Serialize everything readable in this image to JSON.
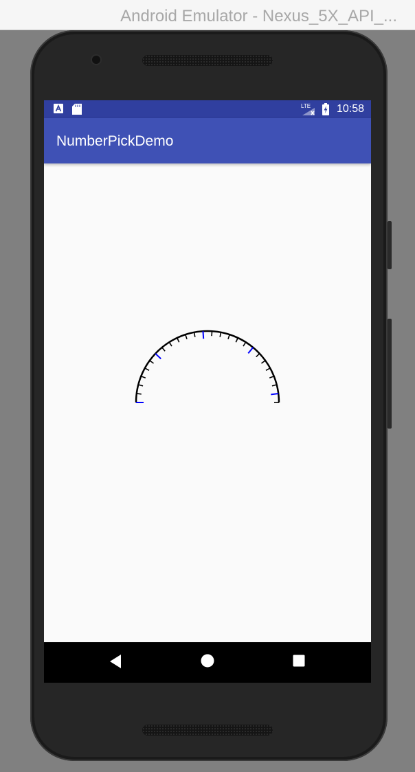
{
  "window": {
    "title": "Android Emulator - Nexus_5X_API_..."
  },
  "status_bar": {
    "time": "10:58",
    "network_label": "LTE",
    "icons": [
      "a-notification-icon",
      "sd-card-icon",
      "lte-signal-icon",
      "battery-charging-icon"
    ]
  },
  "app_bar": {
    "title": "NumberPickDemo"
  },
  "gauge": {
    "start_angle_deg": 180,
    "end_angle_deg": 0,
    "major_tick_count": 5,
    "minor_tick_count": 25,
    "arc_color": "#000000",
    "major_tick_color": "#0000ff",
    "minor_tick_color": "#000000"
  },
  "nav_bar": {
    "buttons": [
      "back-icon",
      "home-icon",
      "recents-icon"
    ]
  },
  "colors": {
    "status_bar": "#303f9f",
    "app_bar": "#3f51b5",
    "screen_bg": "#fafafa",
    "nav_bar": "#000000"
  }
}
